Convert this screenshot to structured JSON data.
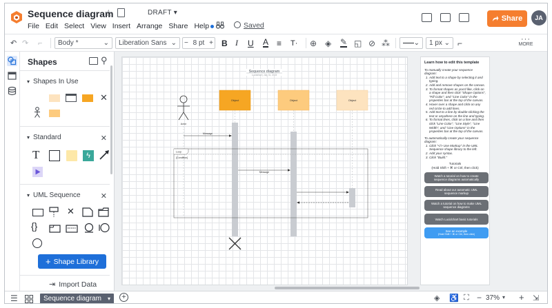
{
  "header": {
    "title": "Sequence diagram",
    "status": "DRAFT",
    "menu": [
      "File",
      "Edit",
      "Select",
      "View",
      "Insert",
      "Arrange",
      "Share",
      "Help"
    ],
    "saved_label": "Saved",
    "share_label": "Share",
    "avatar_initials": "JA"
  },
  "toolbar": {
    "style_select": "Body *",
    "font_select": "Liberation Sans",
    "font_size": "8 pt",
    "line_width": "1 px",
    "more_label": "MORE"
  },
  "panel": {
    "title": "Shapes",
    "sections": [
      "Shapes In Use",
      "Standard",
      "UML Sequence"
    ],
    "shape_library_label": "Shape Library",
    "import_label": "Import Data"
  },
  "diagram": {
    "title": "Sequence diagram",
    "subtitle": "Lucidchart | July 31, 2023",
    "actor_label": "Actor",
    "objects": [
      "Object",
      "Object",
      "Object"
    ],
    "messages": [
      "Message",
      "Message"
    ],
    "loop_label": "Loop",
    "condition_label": "[Condition]"
  },
  "help": {
    "heading": "Learn how to edit this template",
    "manual_intro": "To manually create your sequence diagram:",
    "manual_steps": [
      "Add text to a shape by selecting it and typing.",
      "Add and remove shapes on the canvas.",
      "To format shapes as you'd like, click on a shape and then click \"Shape Options\", \"Fill Color\", and \"Line Color\" in the properties bar at the top of the canvas.",
      "Hover over a shape and click on any red circle to add lines.",
      "Add text to a line by double-clicking the text or anywhere on the line and typing.",
      "To format lines, click on a line and then click \"Line Color\", \"Line Style\", \"Line Width\", and \"Line Options\" in the properties bar at the top of the canvas."
    ],
    "auto_intro": "To automatically create your sequence diagram:",
    "auto_steps": [
      "Click \"</> Use Markup\" in the UML Sequence shape library to the left.",
      "Add your syntax.",
      "Click \"Build.\""
    ],
    "tutorials_label": "Tutorials",
    "tutorials_hint": "(Hold Shift + ⌘ or Ctrl, then click)",
    "buttons": [
      "Watch a tutorial on how to create sequence diagrams automatically",
      "Read about our automatic UML sequence markup",
      "Watch a tutorial on how to make UML sequence diagrams",
      "Watch Lucidchart basic tutorials"
    ],
    "example_label": "See an example",
    "example_hint": "(Hold Shift + ⌘ or Ctrl, then click)"
  },
  "bottom": {
    "page_tab": "Sequence diagram",
    "zoom": "37%"
  },
  "colors": {
    "accent": "#f57e2f",
    "primary": "#1e6fd9",
    "object_dark": "#f6a623",
    "object_mid": "#fdcb7e",
    "object_light": "#fde3bf",
    "lifeline": "#c9ccd1"
  }
}
